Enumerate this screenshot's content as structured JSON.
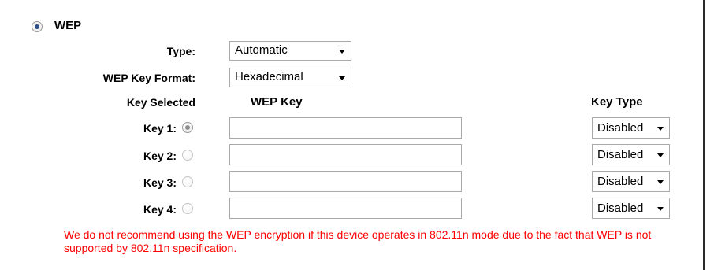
{
  "security": {
    "title": "WEP",
    "selected": true
  },
  "fields": {
    "type_label": "Type:",
    "type_value": "Automatic",
    "format_label": "WEP Key Format:",
    "format_value": "Hexadecimal"
  },
  "table": {
    "col_key_selected": "Key Selected",
    "col_wep_key": "WEP Key",
    "col_key_type": "Key Type",
    "rows": [
      {
        "label": "Key 1:",
        "selected": true,
        "key_value": "",
        "key_type": "Disabled"
      },
      {
        "label": "Key 2:",
        "selected": false,
        "key_value": "",
        "key_type": "Disabled"
      },
      {
        "label": "Key 3:",
        "selected": false,
        "key_value": "",
        "key_type": "Disabled"
      },
      {
        "label": "Key 4:",
        "selected": false,
        "key_value": "",
        "key_type": "Disabled"
      }
    ]
  },
  "warning": {
    "text": "We do not recommend using the WEP encryption if this device operates in 802.11n mode due to the fact that WEP is not supported by 802.11n specification."
  },
  "colors": {
    "warning": "#ff0000",
    "radio_dot": "#2f4f86"
  }
}
